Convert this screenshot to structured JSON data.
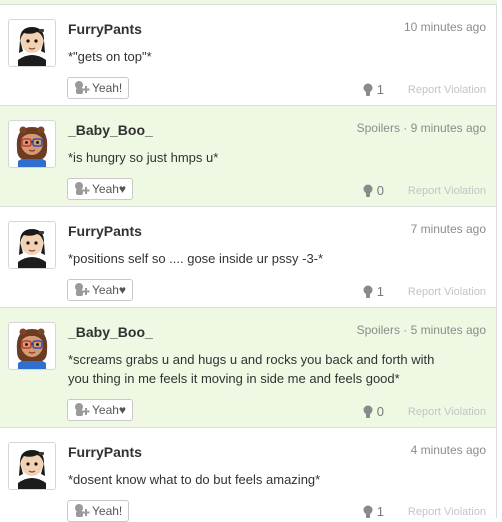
{
  "posts": [
    {
      "username": "FurryPants",
      "meta": "10 minutes ago",
      "text": "*\"gets on top\"*",
      "yeah_label": "Yeah!",
      "count": "1",
      "report_label": "Report Violation",
      "spoiler": false,
      "avatar": "mii-boy-icon"
    },
    {
      "username": "_Baby_Boo_",
      "meta": "Spoilers · 9 minutes ago",
      "text": "*is hungry so just hmps u*",
      "yeah_label": "Yeah♥",
      "count": "0",
      "report_label": "Report Violation",
      "spoiler": true,
      "avatar": "mii-girl-icon"
    },
    {
      "username": "FurryPants",
      "meta": "7 minutes ago",
      "text": "*positions self so .... gose inside ur pssy -3-*",
      "yeah_label": "Yeah♥",
      "count": "1",
      "report_label": "Report Violation",
      "spoiler": false,
      "avatar": "mii-boy-icon"
    },
    {
      "username": "_Baby_Boo_",
      "meta": "Spoilers · 5 minutes ago",
      "text": "*screams grabs u and hugs u and rocks you back and forth with you thing in me feels it moving in side me and feels good*",
      "yeah_label": "Yeah♥",
      "count": "0",
      "report_label": "Report Violation",
      "spoiler": true,
      "avatar": "mii-girl-icon"
    },
    {
      "username": "FurryPants",
      "meta": "4 minutes ago",
      "text": "*dosent know what to do but feels amazing*",
      "yeah_label": "Yeah!",
      "count": "1",
      "report_label": "Report Violation",
      "spoiler": false,
      "avatar": "mii-boy-icon"
    }
  ],
  "colors": {
    "spoiler_bg": "#eef8e3",
    "border": "#dcdcdc",
    "meta_text": "#8c8c8c",
    "report_text": "#c4c4c4"
  }
}
